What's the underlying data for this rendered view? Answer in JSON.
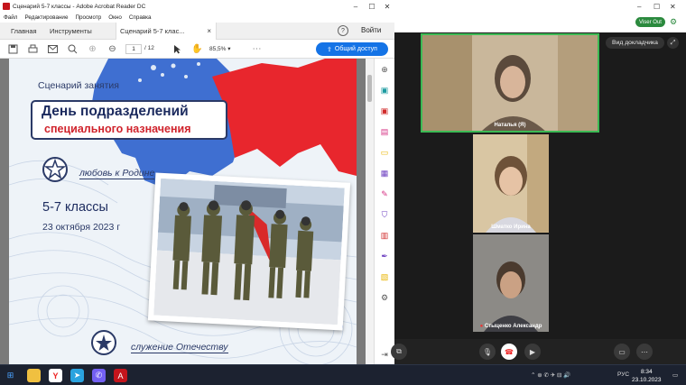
{
  "acrobat": {
    "window_title": "Сценарий 5-7 классы - Adobe Acrobat Reader DC",
    "menu": [
      "Файл",
      "Редактирование",
      "Просмотр",
      "Окно",
      "Справка"
    ],
    "tabs": [
      "Главная",
      "Инструменты",
      "Сценарий 5-7 клас..."
    ],
    "tab_close": "×",
    "help": "?",
    "signin": "Войти",
    "page_current": "1",
    "page_total": "/ 12",
    "zoom": "85,5%",
    "share_label": "Общий доступ"
  },
  "document": {
    "subtitle": "Сценарий занятия",
    "title_line1": "День подразделений",
    "title_line2": "специального назначения",
    "motto_love": "любовь к Родине",
    "grades": "5-7 классы",
    "date": "23 октября 2023 г",
    "motto_service": "служение Отечеству"
  },
  "meeting": {
    "viser_out": "Viser Out",
    "speaker_view": "Вид докладчика",
    "participants": [
      {
        "name": "Наталья (Я)"
      },
      {
        "name": "Шматко Ирина"
      },
      {
        "name": "Стыценко Александр"
      }
    ]
  },
  "taskbar": {
    "lang": "РУС",
    "time": "8:34",
    "date": "23.10.2023"
  },
  "colors": {
    "acrobat_blue": "#1473e6",
    "map_red": "#e8262d",
    "map_blue": "#3f6fd1",
    "navy": "#1b2a5e"
  }
}
